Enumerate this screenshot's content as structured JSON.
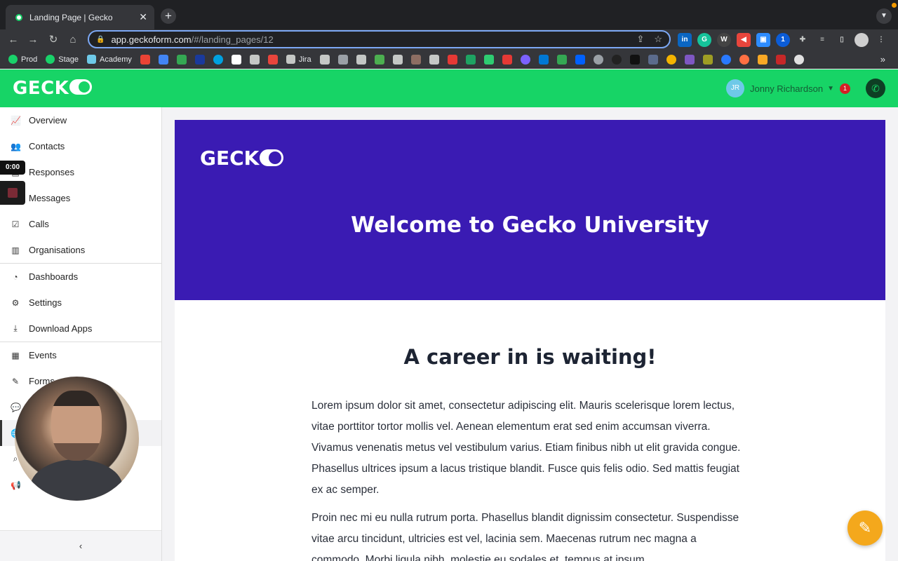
{
  "browser": {
    "tab_title": "Landing Page | Gecko",
    "tab_close": "✕",
    "new_tab": "+",
    "url_host": "app.geckoform.com",
    "url_path": "/#/landing_pages/12",
    "bookmarks": [
      {
        "label": "Prod",
        "color": "#19d26a"
      },
      {
        "label": "Stage",
        "color": "#19d26a"
      },
      {
        "label": "Academy",
        "color": "#6ec9e8"
      },
      {
        "label": "Jira",
        "color": "#e8eaed"
      }
    ],
    "bookmark_overflow": "»"
  },
  "header": {
    "logo_text": "GECK",
    "user_initials": "JR",
    "user_name": "Jonny Richardson",
    "notification_count": "1"
  },
  "sidebar": {
    "items": [
      {
        "label": "Overview",
        "icon": "chart-icon"
      },
      {
        "label": "Contacts",
        "icon": "users-icon"
      },
      {
        "label": "Responses",
        "icon": "inbox-icon"
      },
      {
        "label": "Messages",
        "icon": "message-icon"
      },
      {
        "label": "Calls",
        "icon": "call-icon"
      },
      {
        "label": "Organisations",
        "icon": "building-icon"
      },
      {
        "label": "Dashboards",
        "icon": "gauge-icon"
      },
      {
        "label": "Settings",
        "icon": "gear-icon"
      },
      {
        "label": "Download Apps",
        "icon": "download-icon"
      },
      {
        "label": "Events",
        "icon": "calendar-icon"
      },
      {
        "label": "Forms",
        "icon": "form-icon"
      }
    ],
    "collapse_label": "‹"
  },
  "recorder": {
    "timer": "0:00"
  },
  "page": {
    "hero_logo_text": "GECK",
    "hero_title": "Welcome to Gecko University",
    "heading": "A career in is waiting!",
    "paragraph1": "Lorem ipsum dolor sit amet, consectetur adipiscing elit. Mauris scelerisque lorem lectus, vitae porttitor tortor mollis vel. Aenean elementum erat sed enim accumsan viverra. Vivamus venenatis metus vel vestibulum varius. Etiam finibus nibh ut elit gravida congue. Phasellus ultrices ipsum a lacus tristique blandit. Fusce quis felis odio. Sed mattis feugiat ex ac semper.",
    "paragraph2": "Proin nec mi eu nulla rutrum porta. Phasellus blandit dignissim consectetur. Suspendisse vitae arcu tincidunt, ultricies est vel, lacinia sem. Maecenas rutrum nec magna a commodo. Morbi ligula nibh, molestie eu sodales et, tempus at ipsum."
  },
  "colors": {
    "brand_green": "#17d466",
    "hero_purple": "#3a1bb3",
    "fab_orange": "#f4a81c"
  }
}
